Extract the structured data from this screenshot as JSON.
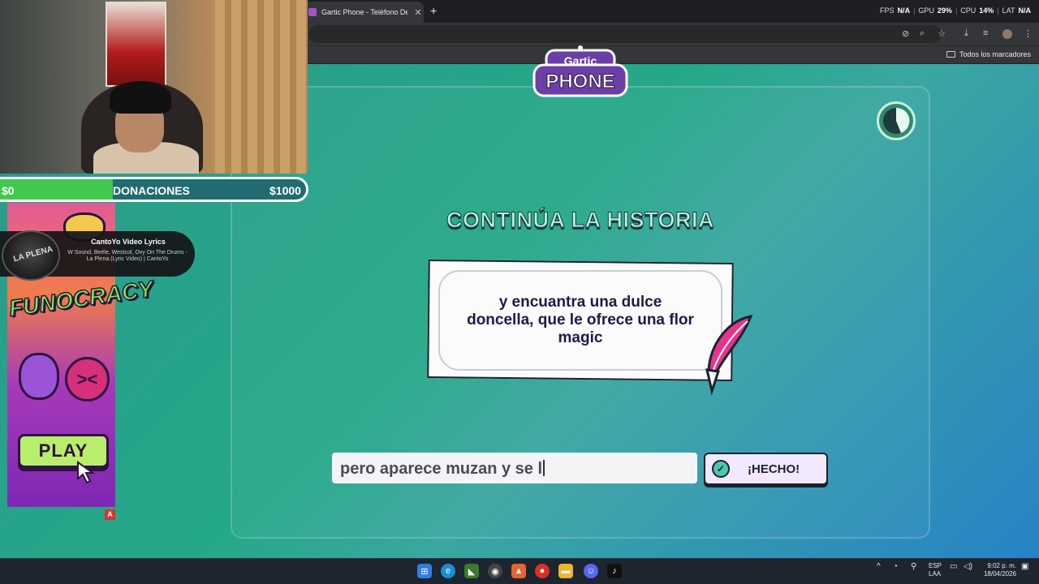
{
  "browser": {
    "tab_title": "Gartic Phone - Teléfono Descon",
    "tab_close": "✕",
    "new_tab": "+",
    "perf": {
      "fps_label": "FPS",
      "fps_value": "N/A",
      "gpu_label": "GPU",
      "gpu_value": "29%",
      "cpu_label": "CPU",
      "cpu_value": "14%",
      "lat_label": "LAT",
      "lat_value": "N/A"
    },
    "bookmarks_label": "Todos los marcadores"
  },
  "game": {
    "logo_top": "Gartic",
    "logo_bottom": "PHONE",
    "heading": "CONTINÚA LA HISTORIA",
    "story_text": "y encuantra una dulce doncella, que le ofrece una flor magic",
    "input_value": "pero aparece muzan y se l",
    "done_label": "¡HECHO!"
  },
  "overlay": {
    "donations": {
      "min": "$0",
      "title": "DONACIONES",
      "max": "$1000",
      "progress": 0.37
    },
    "music": {
      "title": "CantoYo Video Lyrics",
      "subtitle": "W Sound, Beéle, Westcol, Ovy On The Drums - La Plena (Lyric Video) | CantoYo",
      "album_text": "LA PLENA"
    },
    "ad": {
      "brand": "FUNOCRACY",
      "play": "PLAY",
      "badge": "A"
    }
  },
  "taskbar": {
    "lang": "ESP",
    "layout": "LAA",
    "time": "9:02 p. m.",
    "date": "18/04/2026"
  },
  "colors": {
    "accent": "#4bc7b0",
    "heading": "#b9f3da",
    "ink": "#1b2230"
  }
}
